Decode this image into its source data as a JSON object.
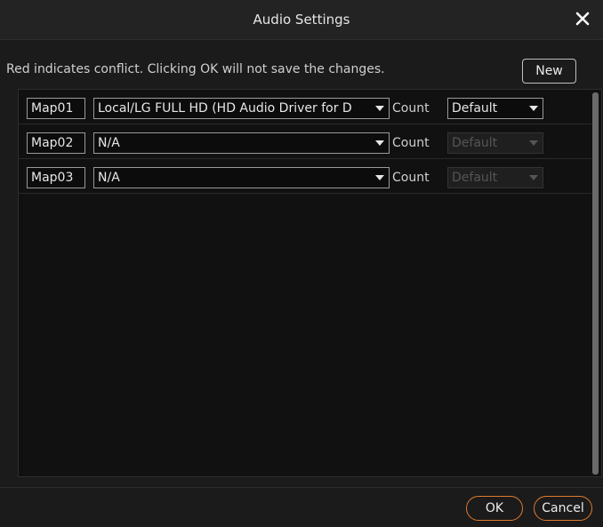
{
  "dialog": {
    "title": "Audio Settings"
  },
  "notice": "Red indicates conflict. Clicking OK will not save the changes.",
  "buttons": {
    "new": "New",
    "ok": "OK",
    "cancel": "Cancel"
  },
  "rows": [
    {
      "map": "Map01",
      "device": "Local/LG FULL HD (HD Audio Driver for D",
      "count_label": "Count",
      "count_value": "Default",
      "count_enabled": true
    },
    {
      "map": "Map02",
      "device": "N/A",
      "count_label": "Count",
      "count_value": "Default",
      "count_enabled": false
    },
    {
      "map": "Map03",
      "device": "N/A",
      "count_label": "Count",
      "count_value": "Default",
      "count_enabled": false
    }
  ],
  "colors": {
    "background": "#1b1b1b",
    "accent": "#e07a2f",
    "panel": "#111111"
  }
}
